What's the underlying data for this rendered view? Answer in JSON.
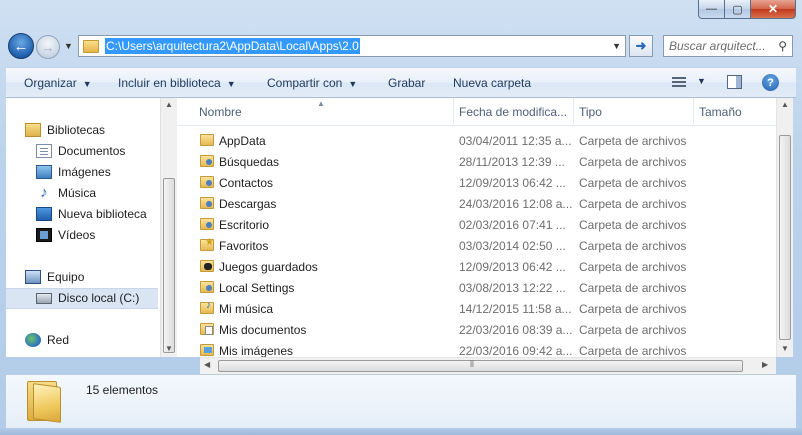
{
  "window": {
    "minimize_glyph": "—",
    "maximize_glyph": "▢",
    "close_glyph": "✕"
  },
  "address": {
    "path": "C:\\Users\\arquitectura2\\AppData\\Local\\Apps\\2.0"
  },
  "search": {
    "placeholder": "Buscar arquitect..."
  },
  "toolbar": {
    "organize": "Organizar",
    "include_library": "Incluir en biblioteca",
    "share_with": "Compartir con",
    "burn": "Grabar",
    "new_folder": "Nueva carpeta"
  },
  "nav": {
    "libraries": "Bibliotecas",
    "documents": "Documentos",
    "images": "Imágenes",
    "music": "Música",
    "new_library": "Nueva biblioteca",
    "videos": "Vídeos",
    "computer": "Equipo",
    "local_disk": "Disco local (C:)",
    "network": "Red"
  },
  "columns": {
    "name": "Nombre",
    "date": "Fecha de modifica...",
    "type": "Tipo",
    "size": "Tamaño"
  },
  "files": [
    {
      "name": "AppData",
      "date": "03/04/2011 12:35 a...",
      "type": "Carpeta de archivos",
      "icon": "folder-icon"
    },
    {
      "name": "Búsquedas",
      "date": "28/11/2013 12:39 ...",
      "type": "Carpeta de archivos",
      "icon": "searches-folder-icon"
    },
    {
      "name": "Contactos",
      "date": "12/09/2013 06:42 ...",
      "type": "Carpeta de archivos",
      "icon": "contacts-folder-icon"
    },
    {
      "name": "Descargas",
      "date": "24/03/2016 12:08 a...",
      "type": "Carpeta de archivos",
      "icon": "downloads-folder-icon"
    },
    {
      "name": "Escritorio",
      "date": "02/03/2016 07:41 ...",
      "type": "Carpeta de archivos",
      "icon": "desktop-folder-icon"
    },
    {
      "name": "Favoritos",
      "date": "03/03/2014 02:50 ...",
      "type": "Carpeta de archivos",
      "icon": "favorites-folder-icon"
    },
    {
      "name": "Juegos guardados",
      "date": "12/09/2013 06:42 ...",
      "type": "Carpeta de archivos",
      "icon": "saved-games-folder-icon"
    },
    {
      "name": "Local Settings",
      "date": "03/08/2013 12:22 ...",
      "type": "Carpeta de archivos",
      "icon": "folder-icon"
    },
    {
      "name": "Mi música",
      "date": "14/12/2015 11:58 a...",
      "type": "Carpeta de archivos",
      "icon": "music-folder-icon"
    },
    {
      "name": "Mis documentos",
      "date": "22/03/2016 08:39 a...",
      "type": "Carpeta de archivos",
      "icon": "documents-folder-icon"
    },
    {
      "name": "Mis imágenes",
      "date": "22/03/2016 09:42 a...",
      "type": "Carpeta de archivos",
      "icon": "pictures-folder-icon"
    }
  ],
  "status": {
    "item_count": "15 elementos"
  }
}
